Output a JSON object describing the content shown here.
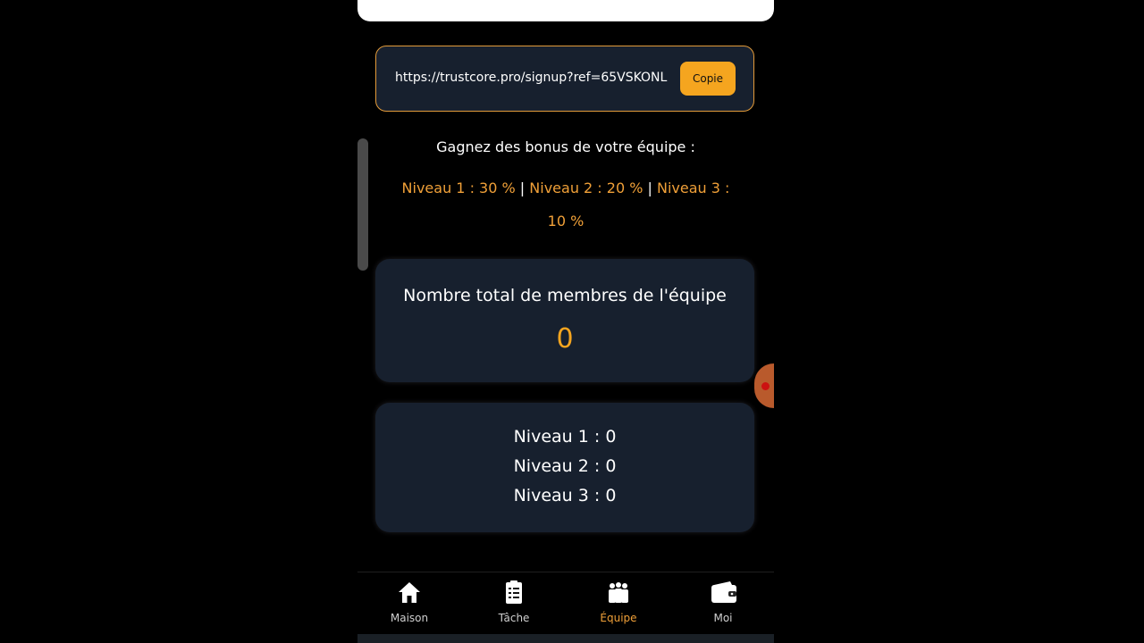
{
  "referral": {
    "link": "https://trustcore.pro/signup?ref=65VSKONL",
    "copy_label": "Copie"
  },
  "bonus": {
    "title": "Gagnez des bonus de votre équipe :",
    "level1": "Niveau 1 : 30 %",
    "level2": "Niveau 2 : 20 %",
    "level3_prefix": "Niveau 3 :",
    "level3_value": "10 %",
    "separator": "|"
  },
  "team_total": {
    "label": "Nombre total de membres de l'équipe",
    "value": "0"
  },
  "team_levels": [
    "Niveau 1 : 0",
    "Niveau 2 : 0",
    "Niveau 3 : 0"
  ],
  "nav": {
    "items": [
      {
        "label": "Maison",
        "icon": "home-icon"
      },
      {
        "label": "Tâche",
        "icon": "clipboard-icon"
      },
      {
        "label": "Équipe",
        "icon": "team-icon"
      },
      {
        "label": "Moi",
        "icon": "wallet-icon"
      }
    ],
    "active_index": 2
  },
  "colors": {
    "accent": "#f5a51f",
    "card_bg": "#17202e",
    "background": "#000000"
  }
}
